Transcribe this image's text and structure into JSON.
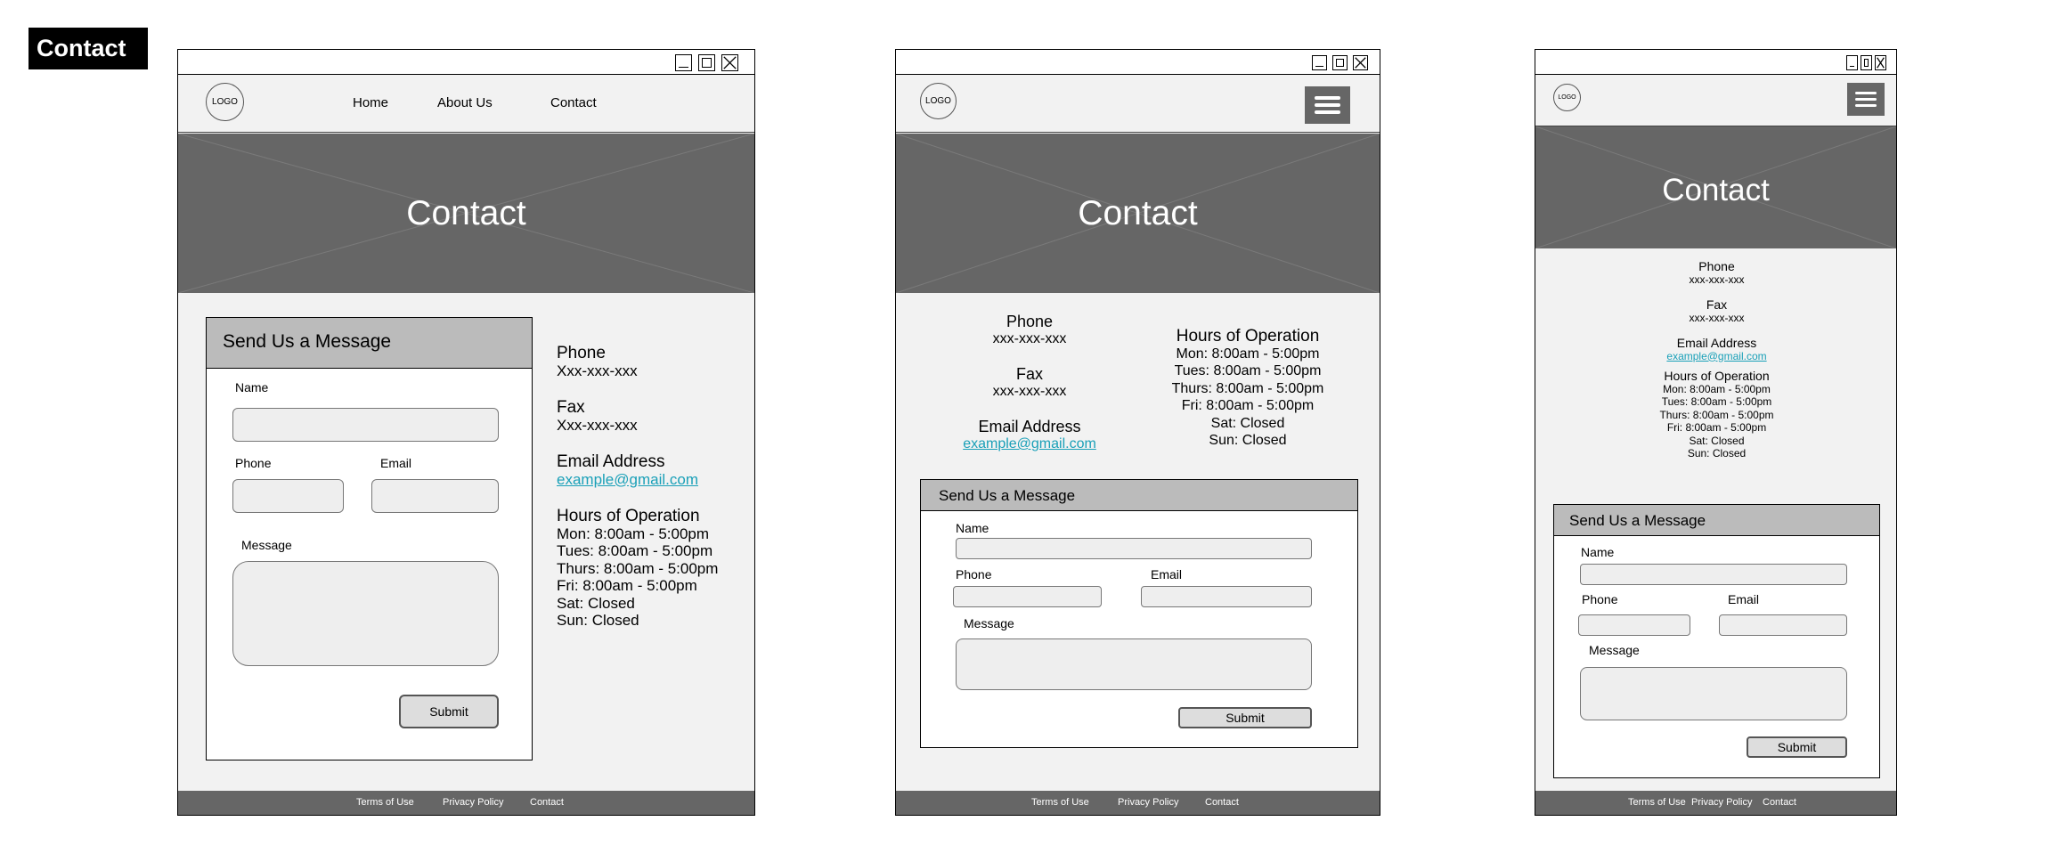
{
  "page_tag": "Contact",
  "logo_text": "LOGO",
  "nav": {
    "home": "Home",
    "about": "About Us",
    "contact": "Contact"
  },
  "hero_title": "Contact",
  "form": {
    "heading": "Send Us a Message",
    "name_label": "Name",
    "phone_label": "Phone",
    "email_label": "Email",
    "message_label": "Message",
    "submit_label": "Submit"
  },
  "info": {
    "phone_label": "Phone",
    "phone_value_desktop": "Xxx-xxx-xxx",
    "phone_value": "xxx-xxx-xxx",
    "fax_label": "Fax",
    "fax_value_desktop": "Xxx-xxx-xxx",
    "fax_value": "xxx-xxx-xxx",
    "email_label": "Email Address",
    "email_value": "example@gmail.com",
    "hours_label": "Hours of Operation",
    "hours": [
      "Mon: 8:00am - 5:00pm",
      "Tues: 8:00am - 5:00pm",
      "Thurs: 8:00am - 5:00pm",
      "Fri: 8:00am - 5:00pm",
      "Sat: Closed",
      "Sun: Closed"
    ]
  },
  "footer": {
    "terms": "Terms of Use",
    "privacy": "Privacy Policy",
    "contact": "Contact"
  },
  "colors": {
    "hero": "#666666",
    "frame_bg": "#f2f2f2",
    "form_header": "#bbbbbb",
    "link": "#1aa0b8",
    "footer": "#666666"
  }
}
